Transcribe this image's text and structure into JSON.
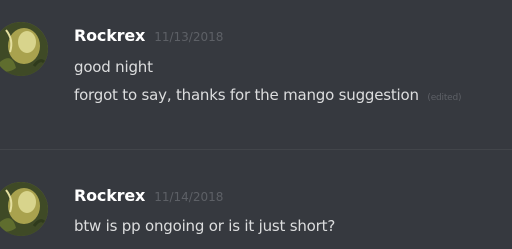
{
  "messages": [
    {
      "author": "Rockrex",
      "timestamp": "11/13/2018",
      "lines": [
        {
          "text": "good night"
        },
        {
          "text": "forgot to say, thanks for the mango suggestion",
          "edited": "(edited)"
        }
      ]
    },
    {
      "author": "Rockrex",
      "timestamp": "11/14/2018",
      "lines": [
        {
          "text": "btw is pp ongoing or is it just short?"
        }
      ]
    }
  ],
  "colors": {
    "background": "#36393f",
    "username": "#ffffff",
    "message_text": "#dcddde",
    "timestamp": "#5d6066",
    "divider": "#42454a"
  },
  "icons": {
    "avatar": "user-avatar-image"
  }
}
